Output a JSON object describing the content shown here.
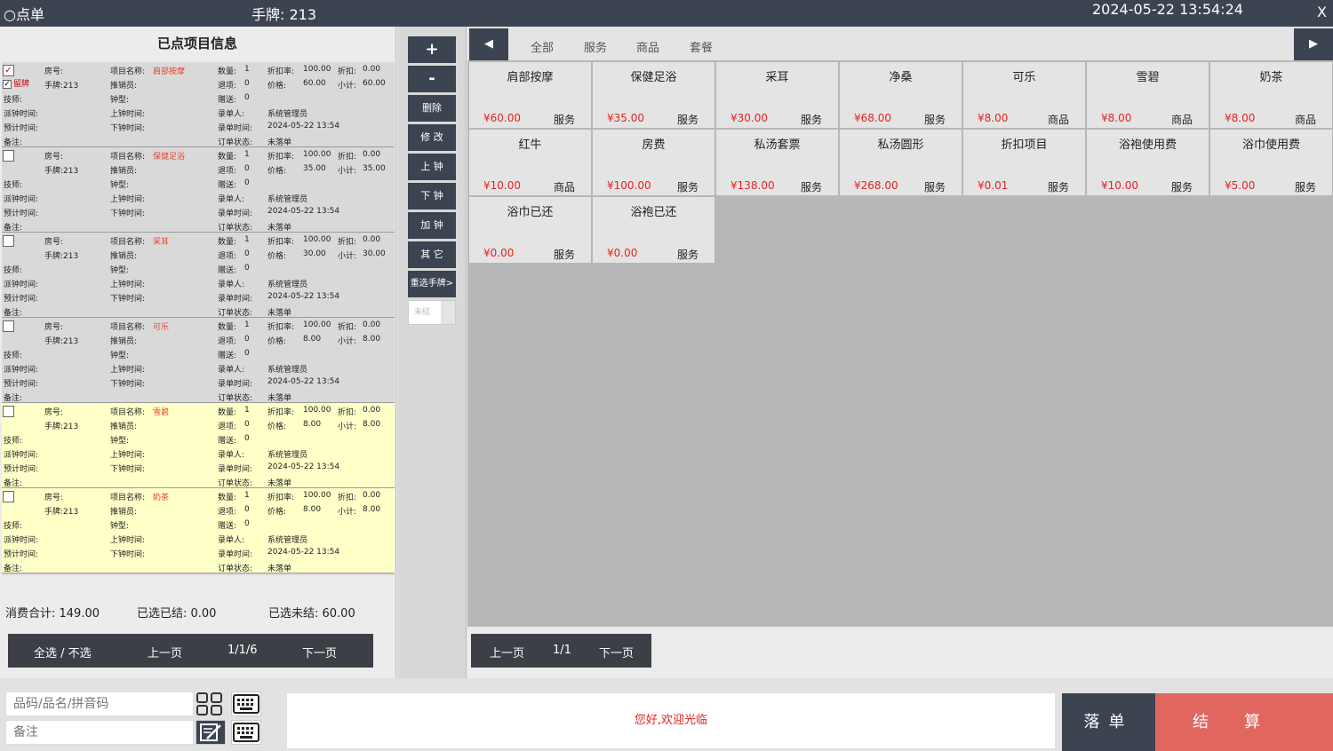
{
  "title": {
    "app": "○点单",
    "tag": "手牌: 213",
    "datetime": "2024-05-22 13:54:24",
    "close": "X"
  },
  "left": {
    "title": "已点项目信息",
    "labels": {
      "room": "房号:",
      "item": "项目名称:",
      "qty": "数量:",
      "rate": "折扣率:",
      "disc": "折扣:",
      "sales": "推销员:",
      "ret": "退项:",
      "price": "价格:",
      "subtotal": "小计:",
      "tech": "技师:",
      "clock": "钟型:",
      "gift": "赠送:",
      "entry": "录单人:",
      "dispatch": "派钟时间:",
      "up": "上钟时间:",
      "time": "录单时间:",
      "est": "预计时间:",
      "down": "下钟时间:",
      "status": "订单状态:",
      "note": "备注:",
      "keep": "留牌"
    },
    "rows": [
      {
        "checked": true,
        "keep": true,
        "tag": "手牌:213",
        "name": "肩部按摩",
        "qty": "1",
        "rate": "100.00",
        "disc": "0.00",
        "ret": "0",
        "price": "60.00",
        "subtotal": "60.00",
        "gift": "0",
        "entry": "系统管理员",
        "time": "2024-05-22 13:54",
        "status": "未落单",
        "highlight": false
      },
      {
        "checked": false,
        "keep": false,
        "tag": "手牌:213",
        "name": "保健足浴",
        "qty": "1",
        "rate": "100.00",
        "disc": "0.00",
        "ret": "0",
        "price": "35.00",
        "subtotal": "35.00",
        "gift": "0",
        "entry": "系统管理员",
        "time": "2024-05-22 13:54",
        "status": "未落单",
        "highlight": false
      },
      {
        "checked": false,
        "keep": false,
        "tag": "手牌:213",
        "name": "采耳",
        "qty": "1",
        "rate": "100.00",
        "disc": "0.00",
        "ret": "0",
        "price": "30.00",
        "subtotal": "30.00",
        "gift": "0",
        "entry": "系统管理员",
        "time": "2024-05-22 13:54",
        "status": "未落单",
        "highlight": false
      },
      {
        "checked": false,
        "keep": false,
        "tag": "手牌:213",
        "name": "可乐",
        "qty": "1",
        "rate": "100.00",
        "disc": "0.00",
        "ret": "0",
        "price": "8.00",
        "subtotal": "8.00",
        "gift": "0",
        "entry": "系统管理员",
        "time": "2024-05-22 13:54",
        "status": "未落单",
        "highlight": false
      },
      {
        "checked": false,
        "keep": false,
        "tag": "手牌:213",
        "name": "雪碧",
        "qty": "1",
        "rate": "100.00",
        "disc": "0.00",
        "ret": "0",
        "price": "8.00",
        "subtotal": "8.00",
        "gift": "0",
        "entry": "系统管理员",
        "time": "2024-05-22 13:54",
        "status": "未落单",
        "highlight": true
      },
      {
        "checked": false,
        "keep": false,
        "tag": "手牌:213",
        "name": "奶茶",
        "qty": "1",
        "rate": "100.00",
        "disc": "0.00",
        "ret": "0",
        "price": "8.00",
        "subtotal": "8.00",
        "gift": "0",
        "entry": "系统管理员",
        "time": "2024-05-22 13:54",
        "status": "未落单",
        "highlight": true
      }
    ],
    "totals": {
      "total": "消费合计: 149.00",
      "settled": "已选已结: 0.00",
      "unsettled": "已选未结: 60.00"
    },
    "pager": {
      "select_all": "全选 / 不选",
      "prev": "上一页",
      "page": "1/1/6",
      "next": "下一页"
    }
  },
  "toolbar": {
    "plus": "+",
    "minus": "-",
    "delete": "删除",
    "edit": "修 改",
    "up": "上 钟",
    "down": "下 钟",
    "add": "加 钟",
    "other": "其 它",
    "reselect": "重选手牌>",
    "status_input": "未结"
  },
  "right": {
    "tabs": [
      "全部",
      "服务",
      "商品",
      "套餐"
    ],
    "prev_arrow": "◀",
    "next_arrow": "▶",
    "products": [
      {
        "name": "肩部按摩",
        "price": "¥60.00",
        "type": "服务"
      },
      {
        "name": "保健足浴",
        "price": "¥35.00",
        "type": "服务"
      },
      {
        "name": "采耳",
        "price": "¥30.00",
        "type": "服务"
      },
      {
        "name": "净桑",
        "price": "¥68.00",
        "type": "服务"
      },
      {
        "name": "可乐",
        "price": "¥8.00",
        "type": "商品"
      },
      {
        "name": "雪碧",
        "price": "¥8.00",
        "type": "商品"
      },
      {
        "name": "奶茶",
        "price": "¥8.00",
        "type": "商品"
      },
      {
        "name": "红牛",
        "price": "¥10.00",
        "type": "商品"
      },
      {
        "name": "房费",
        "price": "¥100.00",
        "type": "服务"
      },
      {
        "name": "私汤套票",
        "price": "¥138.00",
        "type": "服务"
      },
      {
        "name": "私汤圆形",
        "price": "¥268.00",
        "type": "服务"
      },
      {
        "name": "折扣项目",
        "price": "¥0.01",
        "type": "服务"
      },
      {
        "name": "浴袍使用费",
        "price": "¥10.00",
        "type": "服务"
      },
      {
        "name": "浴巾使用费",
        "price": "¥5.00",
        "type": "服务"
      },
      {
        "name": "浴巾已还",
        "price": "¥0.00",
        "type": "服务"
      },
      {
        "name": "浴袍已还",
        "price": "¥0.00",
        "type": "服务"
      }
    ],
    "pager": {
      "prev": "上一页",
      "page": "1/1",
      "next": "下一页"
    }
  },
  "bottom": {
    "search_placeholder": "品码/品名/拼音码",
    "note_placeholder": "备注",
    "message": "您好,欢迎光临",
    "place_order": "落单",
    "settle": "结算"
  }
}
